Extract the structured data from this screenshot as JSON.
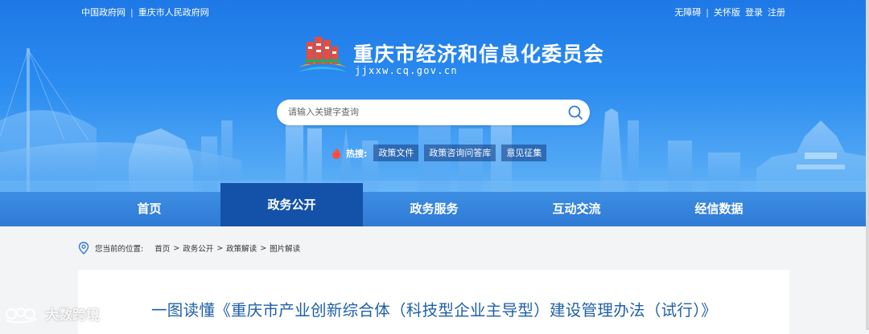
{
  "top_bar": {
    "left_links": [
      "中国政府网",
      "重庆市人民政府网"
    ],
    "right_links": [
      "无障碍",
      "关怀版",
      "登录",
      "注册"
    ]
  },
  "header": {
    "title": "重庆市经济和信息化委员会",
    "domain": "jjxxw.cq.gov.cn",
    "logo_icon": "building-logo-icon"
  },
  "search": {
    "placeholder": "请输入关键字查询",
    "icon": "search-icon"
  },
  "hot_search": {
    "label": "热搜:",
    "icon": "fire-icon",
    "tags": [
      "政策文件",
      "政策咨询问答库",
      "意见征集"
    ]
  },
  "nav": {
    "items": [
      "首页",
      "政务公开",
      "政务服务",
      "互动交流",
      "经信数据"
    ],
    "active_index": 1
  },
  "breadcrumb": {
    "prefix": "您当前的位置:",
    "items": [
      "首页",
      "政务公开",
      "政策解读",
      "图片解读"
    ],
    "separator": ">"
  },
  "article": {
    "title": "一图读懂《重庆市产业创新综合体（科技型企业主导型）建设管理办法（试行）》"
  },
  "watermark": {
    "text": "大数跨境"
  },
  "colors": {
    "hero_top": "#1e78e6",
    "nav_bg": "#2f7ad6",
    "nav_active": "#1452a9",
    "title_blue": "#1e5fa9"
  }
}
